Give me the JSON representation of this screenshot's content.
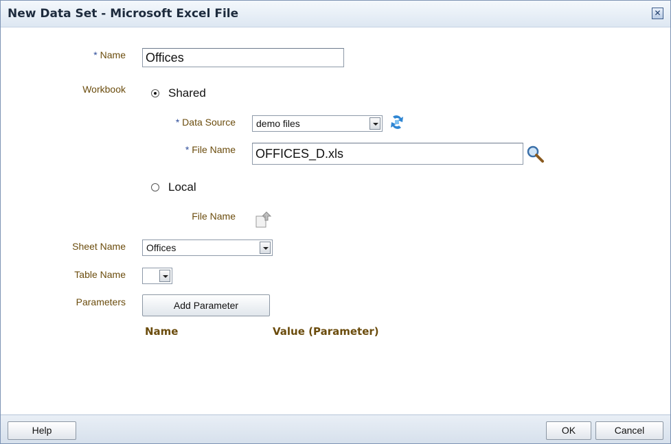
{
  "dialog": {
    "title": "New Data Set - Microsoft Excel File",
    "close_glyph": "✕"
  },
  "form": {
    "required_marker": "*",
    "name_label": "Name",
    "name_value": "Offices",
    "workbook_label": "Workbook",
    "shared_label": "Shared",
    "shared_checked": true,
    "data_source_label": "Data Source",
    "data_source_value": "demo files",
    "shared_file_name_label": "File Name",
    "shared_file_name_value": "OFFICES_D.xls",
    "local_label": "Local",
    "local_checked": false,
    "local_file_name_label": "File Name",
    "sheet_name_label": "Sheet Name",
    "sheet_name_value": "Offices",
    "table_name_label": "Table Name",
    "table_name_value": "",
    "parameters_label": "Parameters",
    "add_parameter_label": "Add Parameter"
  },
  "parameters_table": {
    "columns": [
      "Name",
      "Value (Parameter)"
    ]
  },
  "footer": {
    "help_label": "Help",
    "ok_label": "OK",
    "cancel_label": "Cancel"
  },
  "icons": {
    "refresh": "refresh-icon",
    "search": "search-icon",
    "upload": "upload-icon"
  },
  "colors": {
    "label": "#6b4c0d",
    "required": "#2e4d9a",
    "title_bar": "#dde7f2"
  }
}
